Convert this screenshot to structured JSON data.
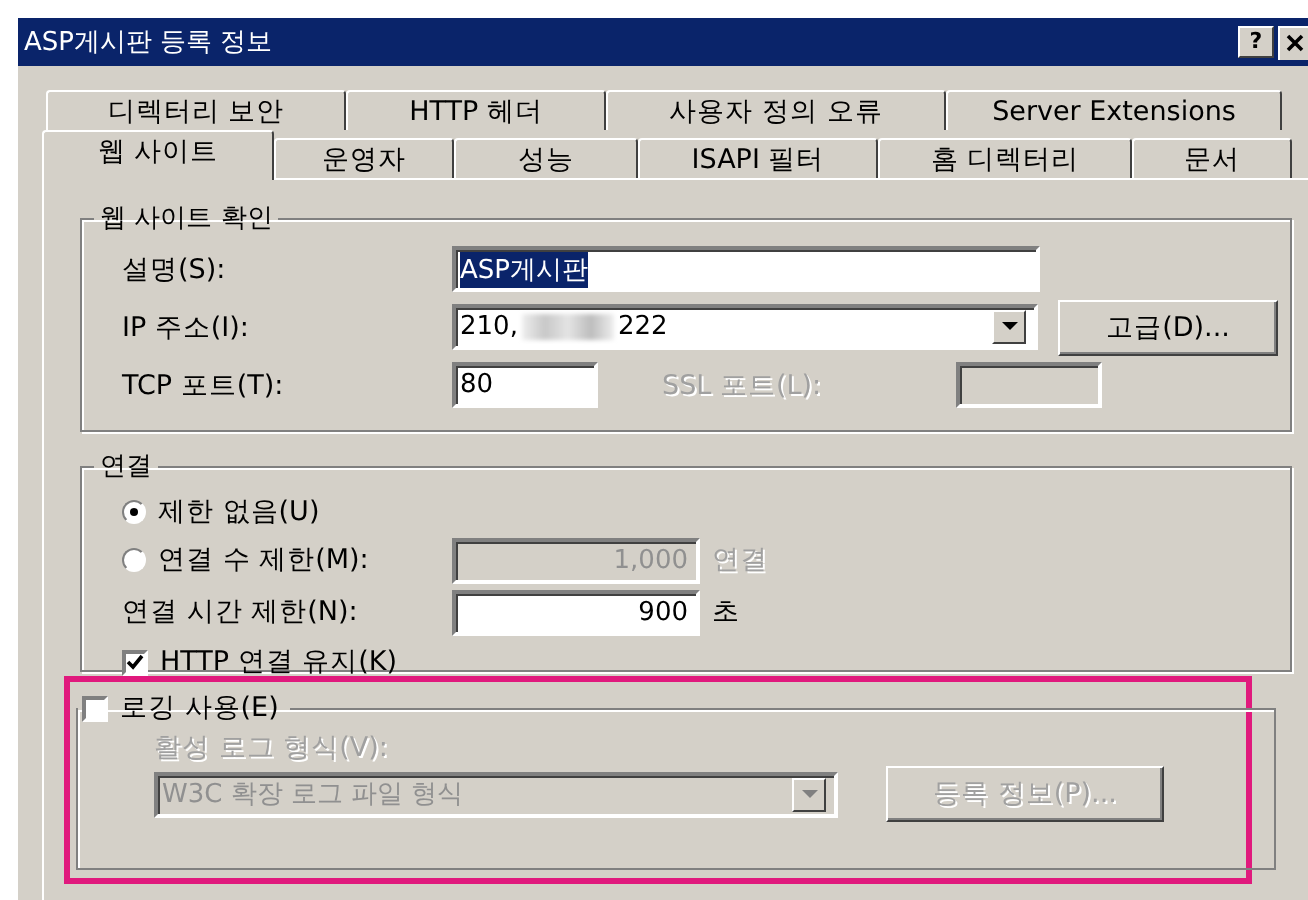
{
  "window": {
    "title": "ASP게시판 등록 정보",
    "help_button": "?"
  },
  "tab_rows": [
    [
      {
        "label": "디렉터리 보안",
        "selected": false
      },
      {
        "label": "HTTP 헤더",
        "selected": false
      },
      {
        "label": "사용자 정의 오류",
        "selected": false
      },
      {
        "label": "Server Extensions",
        "selected": false
      }
    ],
    [
      {
        "label": "웹 사이트",
        "selected": true
      },
      {
        "label": "운영자",
        "selected": false
      },
      {
        "label": "성능",
        "selected": false
      },
      {
        "label": "ISAPI 필터",
        "selected": false
      },
      {
        "label": "홈 디렉터리",
        "selected": false
      },
      {
        "label": "문서",
        "selected": false
      }
    ]
  ],
  "site_group": {
    "title": "웹 사이트 확인",
    "description": {
      "label": "설명(S):",
      "value": "ASP게시판",
      "selected": true
    },
    "ip": {
      "label": "IP 주소(I):",
      "value_start": "210,",
      "value_end": "222"
    },
    "advanced_button": "고급(D)...",
    "tcp": {
      "label": "TCP 포트(T):",
      "value": "80"
    },
    "ssl": {
      "label": "SSL 포트(L):",
      "disabled": true
    }
  },
  "connection_group": {
    "title": "연결",
    "options": [
      {
        "label": "제한 없음(U)",
        "selected": true
      },
      {
        "label": "연결 수 제한(M):",
        "selected": false
      }
    ],
    "limit": {
      "value": "1,000",
      "unit": "연결",
      "disabled": true
    },
    "timeout": {
      "label": "연결 시간 제한(N):",
      "value": "900",
      "unit": "초"
    },
    "keep_alive": {
      "label": "HTTP 연결 유지(K)",
      "checked": true
    }
  },
  "logging_group": {
    "label": "로깅 사용(E)",
    "checked": false,
    "highlighted": true,
    "format_label": "활성 로그 형식(V):",
    "format_value": "W3C 확장 로그 파일 형식",
    "properties_button": "등록 정보(P)..."
  }
}
